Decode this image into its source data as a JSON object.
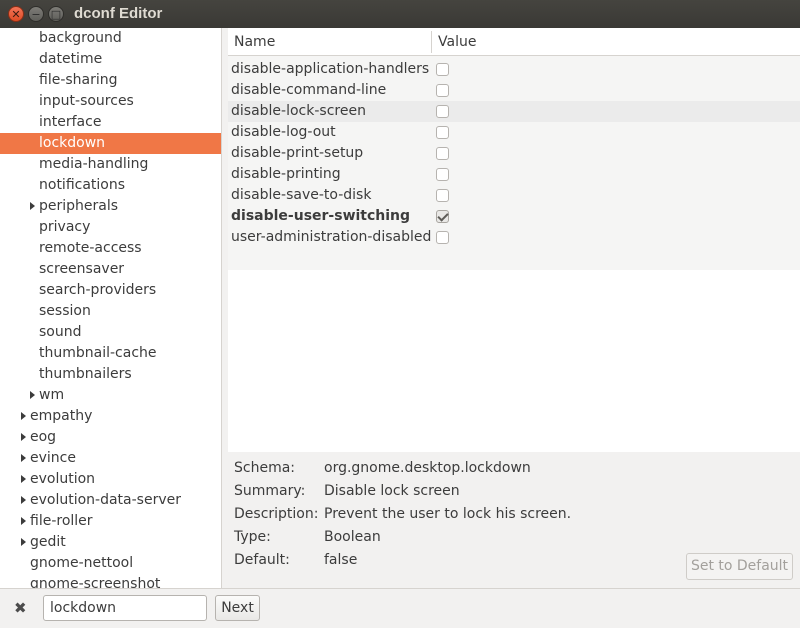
{
  "window": {
    "title": "dconf Editor",
    "close_glyph": "✕",
    "min_glyph": "−",
    "max_glyph": "□"
  },
  "tree": {
    "items": [
      {
        "label": "background",
        "level": 1,
        "expandable": false,
        "selected": false
      },
      {
        "label": "datetime",
        "level": 1,
        "expandable": false,
        "selected": false
      },
      {
        "label": "file-sharing",
        "level": 1,
        "expandable": false,
        "selected": false
      },
      {
        "label": "input-sources",
        "level": 1,
        "expandable": false,
        "selected": false
      },
      {
        "label": "interface",
        "level": 1,
        "expandable": false,
        "selected": false
      },
      {
        "label": "lockdown",
        "level": 1,
        "expandable": false,
        "selected": true
      },
      {
        "label": "media-handling",
        "level": 1,
        "expandable": false,
        "selected": false
      },
      {
        "label": "notifications",
        "level": 1,
        "expandable": false,
        "selected": false
      },
      {
        "label": "peripherals",
        "level": 1,
        "expandable": true,
        "selected": false
      },
      {
        "label": "privacy",
        "level": 1,
        "expandable": false,
        "selected": false
      },
      {
        "label": "remote-access",
        "level": 1,
        "expandable": false,
        "selected": false
      },
      {
        "label": "screensaver",
        "level": 1,
        "expandable": false,
        "selected": false
      },
      {
        "label": "search-providers",
        "level": 1,
        "expandable": false,
        "selected": false
      },
      {
        "label": "session",
        "level": 1,
        "expandable": false,
        "selected": false
      },
      {
        "label": "sound",
        "level": 1,
        "expandable": false,
        "selected": false
      },
      {
        "label": "thumbnail-cache",
        "level": 1,
        "expandable": false,
        "selected": false
      },
      {
        "label": "thumbnailers",
        "level": 1,
        "expandable": false,
        "selected": false
      },
      {
        "label": "wm",
        "level": 1,
        "expandable": true,
        "selected": false
      },
      {
        "label": "empathy",
        "level": 0,
        "expandable": true,
        "selected": false
      },
      {
        "label": "eog",
        "level": 0,
        "expandable": true,
        "selected": false
      },
      {
        "label": "evince",
        "level": 0,
        "expandable": true,
        "selected": false
      },
      {
        "label": "evolution",
        "level": 0,
        "expandable": true,
        "selected": false
      },
      {
        "label": "evolution-data-server",
        "level": 0,
        "expandable": true,
        "selected": false
      },
      {
        "label": "file-roller",
        "level": 0,
        "expandable": true,
        "selected": false
      },
      {
        "label": "gedit",
        "level": 0,
        "expandable": true,
        "selected": false
      },
      {
        "label": "gnome-nettool",
        "level": 0,
        "expandable": false,
        "selected": false
      },
      {
        "label": "gnome-screenshot",
        "level": 0,
        "expandable": false,
        "selected": false
      }
    ]
  },
  "list": {
    "columns": {
      "name": "Name",
      "value": "Value"
    },
    "keys": [
      {
        "name": "disable-application-handlers",
        "checked": false,
        "bold": false,
        "hover": false
      },
      {
        "name": "disable-command-line",
        "checked": false,
        "bold": false,
        "hover": false
      },
      {
        "name": "disable-lock-screen",
        "checked": false,
        "bold": false,
        "hover": true
      },
      {
        "name": "disable-log-out",
        "checked": false,
        "bold": false,
        "hover": false
      },
      {
        "name": "disable-print-setup",
        "checked": false,
        "bold": false,
        "hover": false
      },
      {
        "name": "disable-printing",
        "checked": false,
        "bold": false,
        "hover": false
      },
      {
        "name": "disable-save-to-disk",
        "checked": false,
        "bold": false,
        "hover": false
      },
      {
        "name": "disable-user-switching",
        "checked": true,
        "bold": true,
        "hover": false
      },
      {
        "name": "user-administration-disabled",
        "checked": false,
        "bold": false,
        "hover": false
      }
    ]
  },
  "details": {
    "schema_label": "Schema:",
    "schema_value": "org.gnome.desktop.lockdown",
    "summary_label": "Summary:",
    "summary_value": "Disable lock screen",
    "description_label": "Description:",
    "description_value": "Prevent the user to lock his screen.",
    "type_label": "Type:",
    "type_value": "Boolean",
    "default_label": "Default:",
    "default_value": "false",
    "set_default_label": "Set to Default"
  },
  "search": {
    "close_glyph": "✖",
    "value": "lockdown",
    "next_label": "Next"
  }
}
